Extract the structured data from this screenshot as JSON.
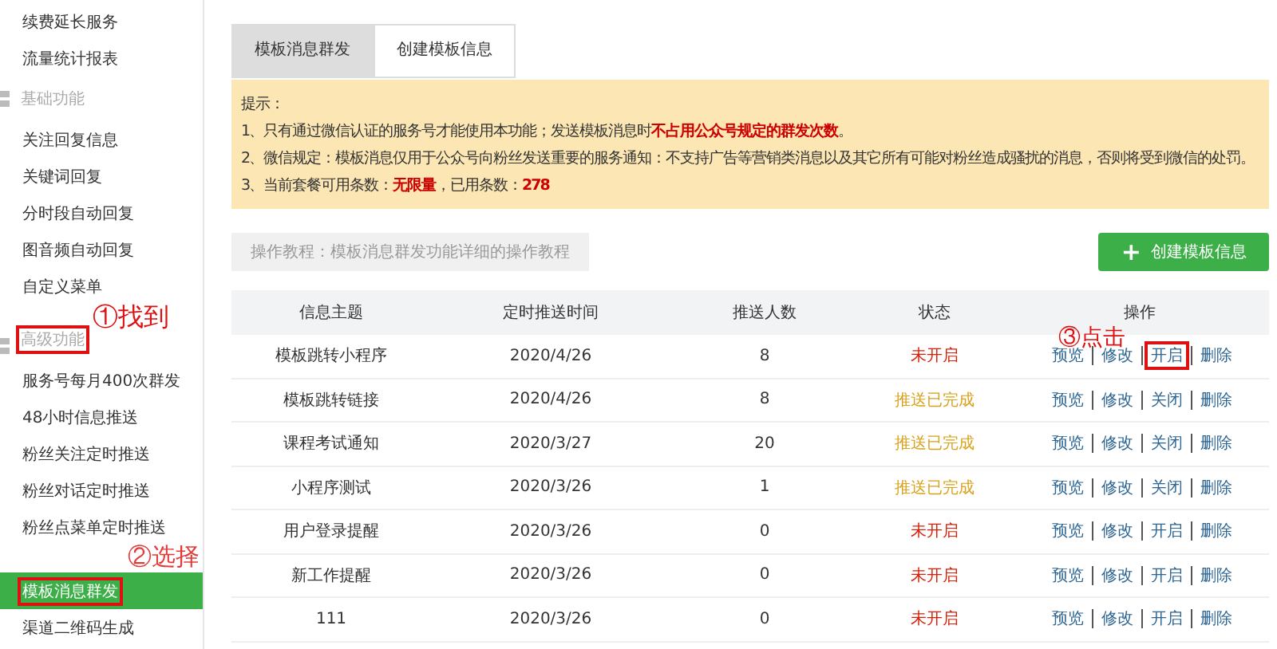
{
  "sidebar": {
    "items": [
      {
        "kind": "item",
        "label": "续费延长服务",
        "selected": false,
        "marked": false
      },
      {
        "kind": "item",
        "label": "流量统计报表",
        "selected": false,
        "marked": false
      },
      {
        "kind": "section",
        "label": "基础功能",
        "marked": false
      },
      {
        "kind": "item",
        "label": "关注回复信息",
        "selected": false,
        "marked": false
      },
      {
        "kind": "item",
        "label": "关键词回复",
        "selected": false,
        "marked": false
      },
      {
        "kind": "item",
        "label": "分时段自动回复",
        "selected": false,
        "marked": false
      },
      {
        "kind": "item",
        "label": "图音频自动回复",
        "selected": false,
        "marked": false
      },
      {
        "kind": "item",
        "label": "自定义菜单",
        "selected": false,
        "marked": false
      },
      {
        "kind": "section",
        "label": "高级功能",
        "marked": true,
        "annotation": "①找到"
      },
      {
        "kind": "item",
        "label": "服务号每月400次群发",
        "selected": false,
        "marked": false
      },
      {
        "kind": "item",
        "label": "48小时信息推送",
        "selected": false,
        "marked": false
      },
      {
        "kind": "item",
        "label": "粉丝关注定时推送",
        "selected": false,
        "marked": false
      },
      {
        "kind": "item",
        "label": "粉丝对话定时推送",
        "selected": false,
        "marked": false
      },
      {
        "kind": "item",
        "label": "粉丝点菜单定时推送",
        "selected": false,
        "marked": false
      },
      {
        "kind": "item",
        "label": "模板消息群发",
        "selected": true,
        "marked": true,
        "annotation": "②选择"
      },
      {
        "kind": "item",
        "label": "渠道二维码生成",
        "selected": false,
        "marked": false
      }
    ]
  },
  "tabs": [
    {
      "label": "模板消息群发",
      "selected": true
    },
    {
      "label": "创建模板信息",
      "selected": false
    }
  ],
  "notice": {
    "title": "提示：",
    "lines": [
      "1、只有通过微信认证的服务号才能使用本功能；发送模板消息时**不占用公众号规定的群发次数**。",
      "2、微信规定：模板消息仅用于公众号向粉丝发送重要的服务通知：不支持广告等营销类消息以及其它所有可能对粉丝造成骚扰的消息，否则将受到微信的处罚。",
      "3、当前套餐可用条数：**无限量**，已用条数：**278**"
    ]
  },
  "tutorial": "操作教程：模板消息群发功能详细的操作教程",
  "create_button": {
    "icon": "+",
    "label": "创建模板信息"
  },
  "table": {
    "columns": [
      "信息主题",
      "定时推送时间",
      "推送人数",
      "状态",
      "操作"
    ],
    "rows": [
      {
        "subject": "模板跳转小程序",
        "time": "2020/4/26",
        "count": "8",
        "status": "未开启",
        "color": "#d81e06",
        "actions": [
          {
            "label": "预览",
            "marked": false
          },
          {
            "label": "修改",
            "marked": false
          },
          {
            "label": "开启",
            "marked": true
          },
          {
            "label": "删除",
            "marked": false
          }
        ],
        "annotation": "③点击"
      },
      {
        "subject": "模板跳转链接",
        "time": "2020/4/26",
        "count": "8",
        "status": "推送已完成",
        "color": "#d8a21a",
        "actions": [
          {
            "label": "预览",
            "marked": false
          },
          {
            "label": "修改",
            "marked": false
          },
          {
            "label": "关闭",
            "marked": false
          },
          {
            "label": "删除",
            "marked": false
          }
        ]
      },
      {
        "subject": "课程考试通知",
        "time": "2020/3/27",
        "count": "20",
        "status": "推送已完成",
        "color": "#d8a21a",
        "actions": [
          {
            "label": "预览",
            "marked": false
          },
          {
            "label": "修改",
            "marked": false
          },
          {
            "label": "关闭",
            "marked": false
          },
          {
            "label": "删除",
            "marked": false
          }
        ]
      },
      {
        "subject": "小程序测试",
        "time": "2020/3/26",
        "count": "1",
        "status": "推送已完成",
        "color": "#d8a21a",
        "actions": [
          {
            "label": "预览",
            "marked": false
          },
          {
            "label": "修改",
            "marked": false
          },
          {
            "label": "关闭",
            "marked": false
          },
          {
            "label": "删除",
            "marked": false
          }
        ]
      },
      {
        "subject": "用户登录提醒",
        "time": "2020/3/26",
        "count": "0",
        "status": "未开启",
        "color": "#d81e06",
        "actions": [
          {
            "label": "预览",
            "marked": false
          },
          {
            "label": "修改",
            "marked": false
          },
          {
            "label": "开启",
            "marked": false
          },
          {
            "label": "删除",
            "marked": false
          }
        ]
      },
      {
        "subject": "新工作提醒",
        "time": "2020/3/26",
        "count": "0",
        "status": "未开启",
        "color": "#d81e06",
        "actions": [
          {
            "label": "预览",
            "marked": false
          },
          {
            "label": "修改",
            "marked": false
          },
          {
            "label": "开启",
            "marked": false
          },
          {
            "label": "删除",
            "marked": false
          }
        ]
      },
      {
        "subject": "111",
        "time": "2020/3/26",
        "count": "0",
        "status": "未开启",
        "color": "#d81e06",
        "actions": [
          {
            "label": "预览",
            "marked": false
          },
          {
            "label": "修改",
            "marked": false
          },
          {
            "label": "开启",
            "marked": false
          },
          {
            "label": "删除",
            "marked": false
          }
        ]
      }
    ]
  }
}
